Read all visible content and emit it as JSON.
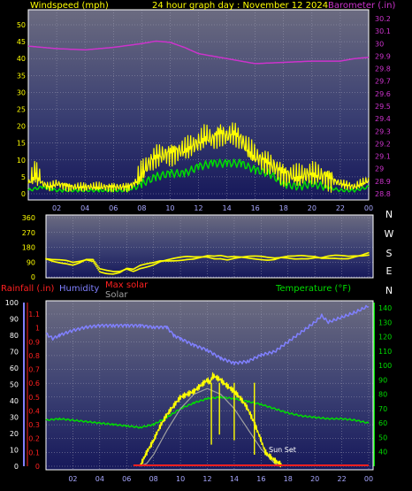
{
  "header": {
    "windspeed_label": "Windspeed (mph)",
    "title": "24 hour graph day : November 12 2024",
    "barometer_label": "Barometer (.in)"
  },
  "labels": {
    "rainfall": "Rainfall (.in)",
    "humidity": "Humidity",
    "max_solar": "Max solar",
    "solar": "Solar",
    "temperature": "Temperature (°F)",
    "sunset": "Sun Set"
  },
  "colors": {
    "wind_gust": "#ffff00",
    "wind_avg": "#00dd00",
    "barometer": "#cc33cc",
    "direction": "#ffff00",
    "humidity": "#8080ff",
    "temperature": "#00dd00",
    "solar": "#ffff00",
    "max_solar": "#a0a0a0",
    "rainfall": "#ff2020"
  },
  "chart_data": [
    {
      "type": "line",
      "title": "24 hour graph day : November 12 2024",
      "xlabel": "",
      "x_ticks": [
        "02",
        "04",
        "06",
        "08",
        "10",
        "12",
        "14",
        "16",
        "18",
        "20",
        "22",
        "00"
      ],
      "y_left": {
        "label": "Windspeed (mph)",
        "ticks": [
          0,
          5,
          10,
          15,
          20,
          25,
          30,
          35,
          40,
          45,
          50
        ],
        "range": [
          0,
          50
        ]
      },
      "y_right": {
        "label": "Barometer (.in)",
        "ticks": [
          "28.8",
          "28.9",
          "29",
          "29.1",
          "29.2",
          "29.3",
          "29.4",
          "29.5",
          "29.6",
          "29.7",
          "29.8",
          "29.9",
          "30",
          "30.1",
          "30.2"
        ],
        "range": [
          28.8,
          30.2
        ]
      },
      "series": [
        {
          "name": "Windspeed",
          "axis": "left",
          "x": [
            0,
            0.5,
            1,
            1.5,
            2,
            3,
            4,
            5,
            6,
            7,
            7.5,
            8,
            8.5,
            9,
            10,
            11,
            12,
            12.5,
            13,
            13.5,
            14,
            14.5,
            15,
            15.5,
            16,
            16.5,
            17,
            18,
            19,
            20,
            21,
            22,
            23,
            24
          ],
          "values": [
            3,
            6,
            3,
            2,
            3,
            2,
            2,
            2,
            2,
            2,
            3,
            6,
            9,
            11,
            12,
            13,
            15,
            17,
            16,
            18,
            17,
            18,
            16,
            13,
            11,
            10,
            9,
            6,
            5,
            6,
            5,
            3,
            2,
            4
          ]
        },
        {
          "name": "Wind average",
          "axis": "left",
          "x": [
            0,
            1,
            2,
            3,
            4,
            5,
            6,
            7,
            8,
            9,
            10,
            11,
            12,
            13,
            14,
            15,
            16,
            17,
            18,
            19,
            20,
            21,
            22,
            23,
            24
          ],
          "values": [
            1,
            2,
            1,
            1,
            1,
            1,
            1,
            1,
            3,
            5,
            6,
            6,
            8,
            9,
            9,
            9,
            7,
            6,
            3,
            2,
            3,
            2,
            1,
            1,
            2
          ]
        },
        {
          "name": "Barometer",
          "axis": "right",
          "x": [
            0,
            2,
            4,
            6,
            8,
            9,
            10,
            11,
            12,
            14,
            16,
            18,
            20,
            22,
            23,
            24
          ],
          "values": [
            29.98,
            29.96,
            29.95,
            29.97,
            30.0,
            30.02,
            30.01,
            29.97,
            29.92,
            29.88,
            29.84,
            29.85,
            29.86,
            29.86,
            29.88,
            29.89
          ]
        }
      ]
    },
    {
      "type": "scatter",
      "title": "",
      "y_left": {
        "ticks": [
          0,
          90,
          180,
          270,
          360
        ],
        "range": [
          0,
          360
        ]
      },
      "y_right": {
        "ticks": [
          "N",
          "W",
          "S",
          "E",
          "N"
        ]
      },
      "series": [
        {
          "name": "Wind direction",
          "x": [
            0,
            0.5,
            1,
            1.5,
            2,
            2.5,
            3,
            3.5,
            4,
            4.5,
            5,
            5.5,
            6,
            6.5,
            7,
            7.5,
            8,
            8.5,
            9,
            9.5,
            10,
            10.5,
            11,
            11.5,
            12,
            12.5,
            13,
            13.5,
            14,
            14.5,
            15,
            15.5,
            16,
            16.5,
            17,
            17.5,
            18,
            18.5,
            19,
            19.5,
            20,
            20.5,
            21,
            21.5,
            22,
            22.5,
            23,
            23.5,
            24
          ],
          "values": [
            110,
            100,
            95,
            90,
            80,
            90,
            105,
            100,
            40,
            30,
            25,
            30,
            50,
            40,
            60,
            70,
            80,
            95,
            100,
            105,
            110,
            115,
            115,
            120,
            125,
            118,
            120,
            112,
            118,
            120,
            120,
            118,
            115,
            110,
            110,
            118,
            120,
            118,
            120,
            118,
            120,
            115,
            120,
            122,
            120,
            118,
            125,
            130,
            140
          ]
        }
      ]
    },
    {
      "type": "line",
      "title": "",
      "y_left_rain": {
        "label": "Rainfall (.in)",
        "ticks": [
          "0",
          "0.1",
          "0.2",
          "0.3",
          "0.4",
          "0.5",
          "0.6",
          "0.7",
          "0.8",
          "0.9",
          "1",
          "1.1"
        ],
        "range": [
          0,
          1.1
        ]
      },
      "y_left_humidity": {
        "label": "Humidity",
        "ticks": [
          0,
          10,
          20,
          30,
          40,
          50,
          60,
          70,
          80,
          90,
          100
        ],
        "range": [
          0,
          100
        ]
      },
      "y_right": {
        "label": "Temperature (°F)",
        "ticks": [
          40,
          50,
          60,
          70,
          80,
          90,
          100,
          110,
          120,
          130,
          140
        ],
        "range": [
          30,
          145
        ]
      },
      "series": [
        {
          "name": "Humidity",
          "x": [
            0,
            0.5,
            1,
            2,
            3,
            4,
            5,
            6,
            7,
            8,
            9,
            9.5,
            10,
            11,
            12,
            13,
            14,
            15,
            16,
            17,
            18,
            19,
            20,
            20.5,
            21,
            22,
            23,
            24
          ],
          "values": [
            81,
            78,
            80,
            83,
            85,
            86,
            86,
            86,
            86,
            85,
            85,
            80,
            78,
            74,
            71,
            66,
            63,
            64,
            68,
            70,
            76,
            82,
            88,
            92,
            88,
            91,
            94,
            98
          ]
        },
        {
          "name": "Temperature",
          "axis": "right",
          "x": [
            0,
            1,
            2,
            3,
            4,
            5,
            6,
            7,
            8,
            9,
            10,
            11,
            12,
            13,
            14,
            15,
            16,
            17,
            18,
            19,
            20,
            21,
            22,
            23,
            24
          ],
          "values": [
            62,
            63,
            62,
            61,
            60,
            59,
            58,
            57,
            59,
            64,
            70,
            74,
            77,
            78,
            77,
            75,
            73,
            70,
            67,
            65,
            64,
            63,
            63,
            62,
            60
          ]
        },
        {
          "name": "Solar",
          "axis": "right",
          "x": [
            7.0,
            7.4,
            8,
            8.5,
            9,
            9.5,
            10,
            10.5,
            11,
            11.5,
            12,
            12.2,
            12.4,
            12.6,
            12.8,
            13,
            13.2,
            13.6,
            14,
            14.4,
            14.8,
            15,
            15.5,
            16,
            16.3,
            16.5,
            17,
            17.5
          ],
          "values": [
            30,
            38,
            48,
            58,
            66,
            72,
            78,
            80,
            82,
            86,
            90,
            88,
            93,
            92,
            91,
            90,
            88,
            85,
            82,
            78,
            73,
            70,
            60,
            48,
            40,
            38,
            34,
            31
          ]
        },
        {
          "name": "Max solar",
          "axis": "right",
          "x": [
            7.0,
            7.5,
            8,
            9,
            10,
            11,
            12,
            13,
            14,
            15,
            16,
            17,
            17.5
          ],
          "values": [
            30,
            32,
            38,
            55,
            70,
            80,
            84,
            80,
            70,
            56,
            42,
            32,
            30
          ]
        },
        {
          "name": "Rainfall",
          "axis": "left_rain",
          "x": [
            6.5,
            24
          ],
          "values": [
            0.001,
            0.001
          ]
        }
      ]
    }
  ]
}
